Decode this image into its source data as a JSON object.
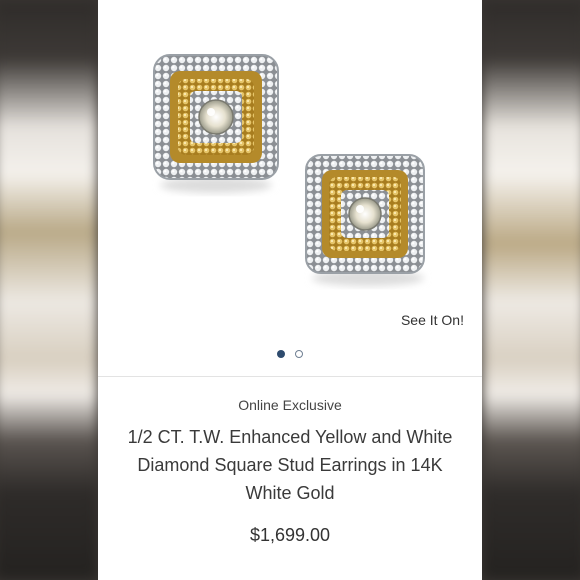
{
  "product": {
    "see_it_on": "See It On!",
    "badge": "Online Exclusive",
    "title": "1/2 CT. T.W. Enhanced Yellow and White Diamond Square Stud Earrings in 14K White Gold",
    "price": "$1,699.00"
  },
  "gallery": {
    "image_count": 2,
    "active_index": 0
  },
  "icons": {
    "wishlist": "heart-icon"
  },
  "colors": {
    "dot_active": "#2e4b6e",
    "text": "#3a3a3a",
    "gold": "#d9b65c"
  }
}
